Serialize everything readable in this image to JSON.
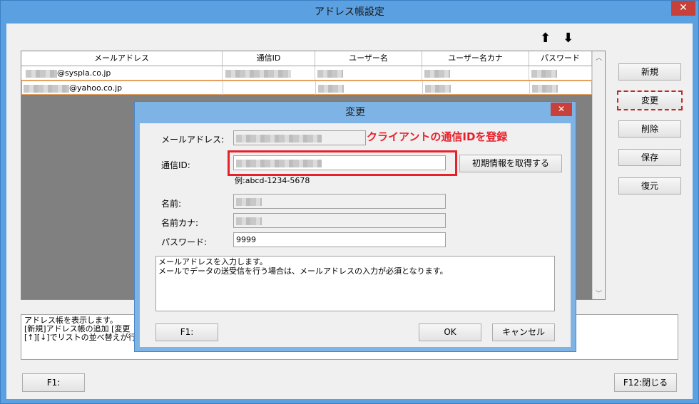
{
  "window": {
    "title": "アドレス帳設定",
    "close_glyph": "✕"
  },
  "toolbar": {
    "up_arrow": "⬆",
    "down_arrow": "⬇"
  },
  "grid": {
    "columns": [
      "メールアドレス",
      "通信ID",
      "ユーザー名",
      "ユーザー名カナ",
      "パスワード"
    ],
    "rows": [
      {
        "email": "@syspla.co.jp"
      },
      {
        "email": "@yahoo.co.jp"
      }
    ]
  },
  "side_buttons": {
    "new": "新規",
    "change": "変更",
    "delete": "削除",
    "save": "保存",
    "restore": "復元"
  },
  "status_panel": {
    "line1": "アドレス帳を表示します。",
    "line2": "[新規]アドレス帳の追加 [変更",
    "line3": "[↑][↓]でリストの並べ替えが行"
  },
  "bottom_buttons": {
    "f1": "F1:",
    "f12": "F12:閉じる"
  },
  "dialog": {
    "title": "変更",
    "close_glyph": "✕",
    "annotation": "クライアントの通信IDを登録",
    "labels": {
      "email": "メールアドレス:",
      "comm_id": "通信ID:",
      "name": "名前:",
      "name_kana": "名前カナ:",
      "password": "パスワード:"
    },
    "example": "例:abcd-1234-5678",
    "fetch_button": "初期情報を取得する",
    "password_value": "9999",
    "help_line1": "メールアドレスを入力します。",
    "help_line2": "メールでデータの送受信を行う場合は、メールアドレスの入力が必須となります。",
    "f1_button": "F1:",
    "ok_button": "OK",
    "cancel_button": "キャンセル",
    "colors": {
      "annotation": "#e8202a"
    }
  }
}
